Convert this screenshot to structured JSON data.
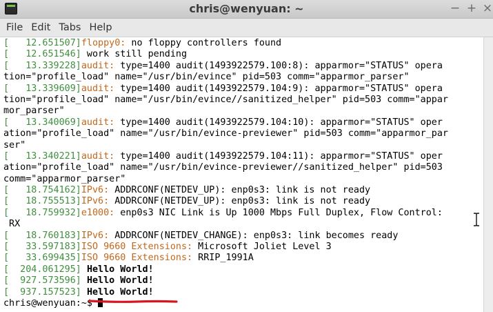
{
  "window": {
    "title": "chris@wenyuan: ~",
    "controls": {
      "minimize": "−",
      "maximize": "+",
      "close": "×"
    }
  },
  "menu": [
    "File",
    "Edit",
    "Tabs",
    "Help"
  ],
  "colors": {
    "timestamp": "#3f8f3f",
    "subsystem": "#c4661a",
    "annotation_underline": "#d9141f"
  },
  "terminal": {
    "lines": [
      {
        "ts": "[   12.651507]",
        "sub": "floppy0:",
        "text": " no floppy controllers found"
      },
      {
        "ts": "[   12.651546]",
        "text": " work still pending"
      },
      {
        "ts": "[   13.339228]",
        "sub": "audit:",
        "text": " type=1400 audit(1493922579.100:8): apparmor=\"STATUS\" opera"
      },
      {
        "text": "tion=\"profile_load\" name=\"/usr/bin/evince\" pid=503 comm=\"apparmor_parser\""
      },
      {
        "ts": "[   13.339609]",
        "sub": "audit:",
        "text": " type=1400 audit(1493922579.104:9): apparmor=\"STATUS\" opera"
      },
      {
        "text": "tion=\"profile_load\" name=\"/usr/bin/evince//sanitized_helper\" pid=503 comm=\"appar"
      },
      {
        "text": "mor_parser\""
      },
      {
        "ts": "[   13.340069]",
        "sub": "audit:",
        "text": " type=1400 audit(1493922579.104:10): apparmor=\"STATUS\" oper"
      },
      {
        "text": "ation=\"profile_load\" name=\"/usr/bin/evince-previewer\" pid=503 comm=\"apparmor_par"
      },
      {
        "text": "ser\""
      },
      {
        "ts": "[   13.340221]",
        "sub": "audit:",
        "text": " type=1400 audit(1493922579.104:11): apparmor=\"STATUS\" oper"
      },
      {
        "text": "ation=\"profile_load\" name=\"/usr/bin/evince-previewer//sanitized_helper\" pid=503"
      },
      {
        "text": "comm=\"apparmor_parser\""
      },
      {
        "ts": "[   18.754162]",
        "sub": "IPv6:",
        "text": " ADDRCONF(NETDEV_UP): enp0s3: link is not ready"
      },
      {
        "ts": "[   18.755513]",
        "sub": "IPv6:",
        "text": " ADDRCONF(NETDEV_UP): enp0s3: link is not ready"
      },
      {
        "ts": "[   18.759932]",
        "sub": "e1000:",
        "text": " enp0s3 NIC Link is Up 1000 Mbps Full Duplex, Flow Control:"
      },
      {
        "text": " RX"
      },
      {
        "ts": "[   18.760183]",
        "sub": "IPv6:",
        "text": " ADDRCONF(NETDEV_CHANGE): enp0s3: link becomes ready"
      },
      {
        "ts": "[   33.597183]",
        "sub": "ISO 9660 Extensions:",
        "text": " Microsoft Joliet Level 3"
      },
      {
        "ts": "[   33.699435]",
        "sub": "ISO 9660 Extensions:",
        "text": " RRIP_1991A"
      },
      {
        "ts": "[  204.061295]",
        "text": " ",
        "bold": "Hello World!"
      },
      {
        "ts": "[  927.573596]",
        "text": " ",
        "bold": "Hello World!"
      },
      {
        "ts": "[  937.157523]",
        "text": " ",
        "bold": "Hello World!"
      }
    ],
    "prompt": "chris@wenyuan:~$ "
  },
  "icons": {
    "app": "terminal-icon",
    "pointer": "ibeam-cursor-icon"
  }
}
